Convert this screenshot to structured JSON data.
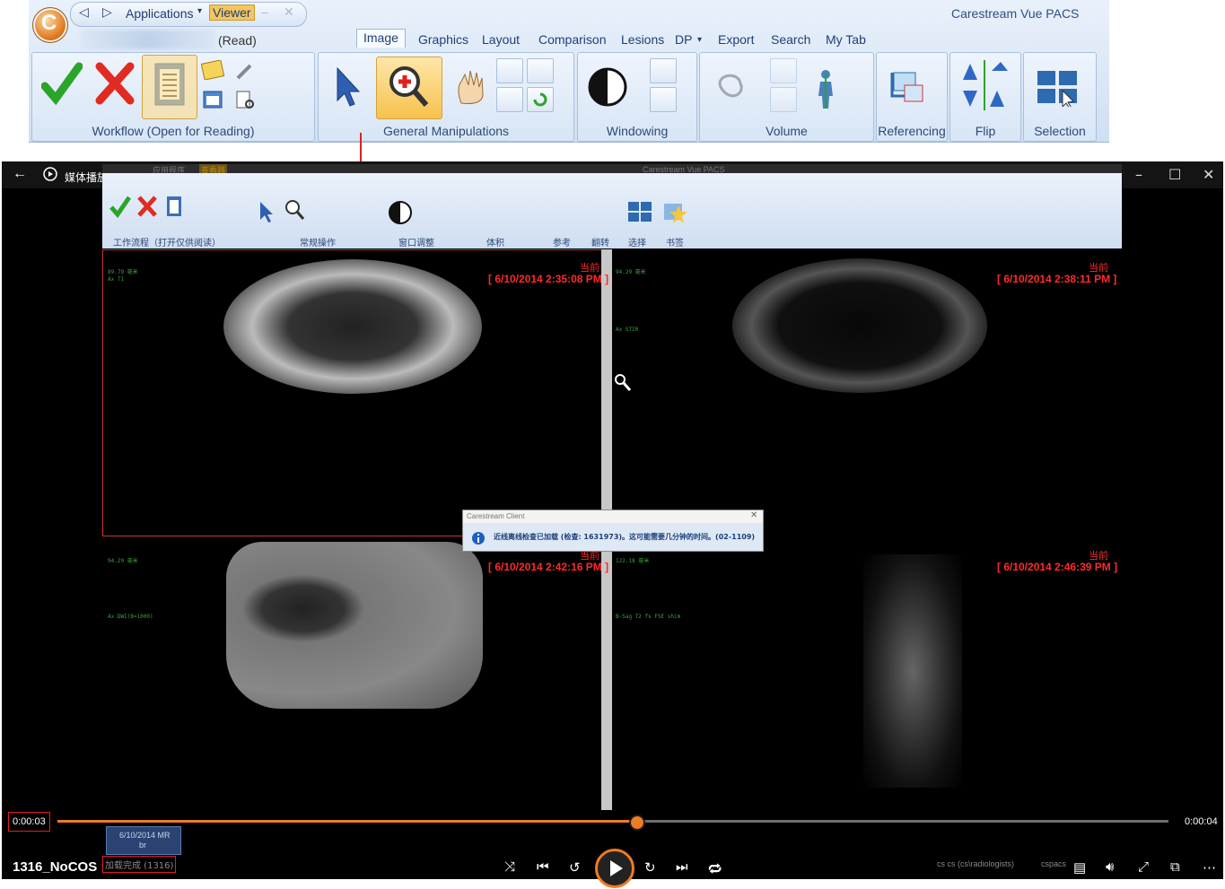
{
  "ribbon": {
    "nav_applications": "Applications",
    "nav_viewer": "Viewer",
    "brand": "Carestream Vue PACS",
    "read_label": "(Read)",
    "tabs": [
      "Image",
      "Graphics",
      "Layout",
      "Comparison",
      "Lesions",
      "DP",
      "Export",
      "Search",
      "My Tab"
    ],
    "active_tab": "Image",
    "groups": [
      "Workflow (Open for Reading)",
      "General Manipulations",
      "Windowing",
      "Volume",
      "Referencing",
      "Flip",
      "Selection"
    ]
  },
  "player": {
    "title": "媒体播放器",
    "time_current": "0:00:03",
    "time_total": "0:00:04",
    "file_name": "1316_NoCOS",
    "progress_fraction": 0.52
  },
  "inner": {
    "title": "Carestream Vue PACS",
    "app_menu": "应用程序",
    "viewer": "查看器",
    "groups": [
      "工作流程（打开仅供阅读）",
      "常规操作",
      "窗口调整",
      "体积",
      "参考",
      "翻转",
      "选择",
      "书签"
    ],
    "now_label": "当前",
    "viewports": [
      {
        "date": "[ 6/10/2014 2:35:08 PM ]",
        "series": "Ax T1",
        "pos": "89.79 毫米"
      },
      {
        "date": "[ 6/10/2014 2:38:11 PM ]",
        "series": "Ax STIR",
        "pos": "94.29 毫米"
      },
      {
        "date": "[ 6/10/2014 2:42:16 PM ]",
        "series": "Ax DWI(B=1000)",
        "pos": "94.29 毫米"
      },
      {
        "date": "[ 6/10/2014 2:46:39 PM ]",
        "series": "B-Sag T2 fs FSE shim",
        "pos": "122.18 毫米"
      }
    ],
    "dialog_title": "Carestream Client",
    "dialog_message": "近线离线检查已加载 (检查: 1631973)。这可能需要几分钟的时间。(02-1109)",
    "thumb_label": "6/10/2014 MR",
    "thumb_sub": "br",
    "loading_status": "加载完成 (1316)",
    "status_user": "cs cs (cs\\radiologists)",
    "status_server": "cspacs"
  }
}
